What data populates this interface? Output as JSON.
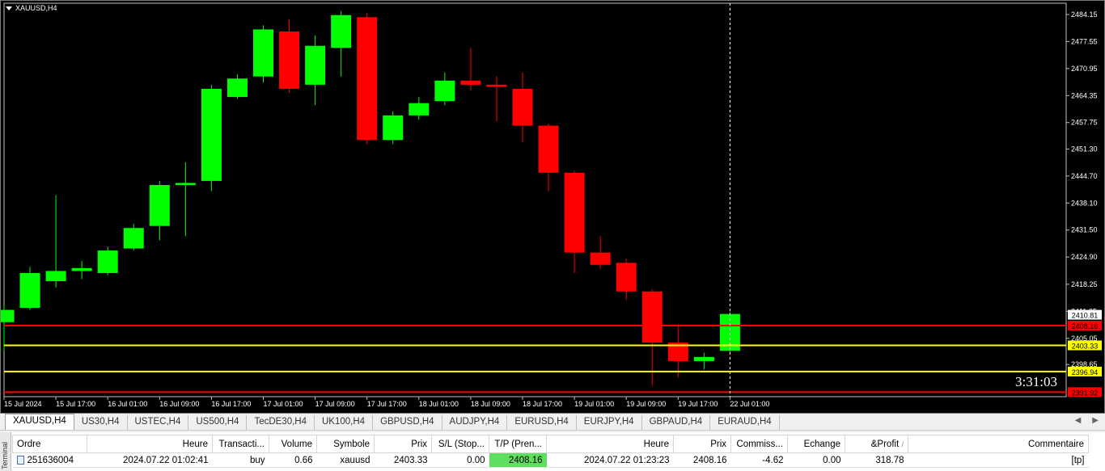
{
  "chart_title": "XAUUSD,H4",
  "countdown": "3:31:03",
  "colors": {
    "background": "#000000",
    "bull": "#00ff00",
    "bear": "#ff0000",
    "axis_text": "#ffffff",
    "yellow_line": "#ffff00",
    "red_line": "#ff0000",
    "tp_highlight": "#5ee05e"
  },
  "chart_data": {
    "type": "candlestick",
    "title": "XAUUSD,H4",
    "ylim": [
      2390.8,
      2486.9
    ],
    "y_ticks": [
      2484.15,
      2477.55,
      2470.95,
      2464.35,
      2457.75,
      2451.3,
      2444.7,
      2438.1,
      2431.5,
      2424.9,
      2418.25,
      2411.65,
      2405.05,
      2398.65
    ],
    "x_labels": [
      "15 Jul 2024",
      "15 Jul 17:00",
      "16 Jul 01:00",
      "16 Jul 09:00",
      "16 Jul 17:00",
      "17 Jul 01:00",
      "17 Jul 09:00",
      "17 Jul 17:00",
      "18 Jul 01:00",
      "18 Jul 09:00",
      "18 Jul 17:00",
      "19 Jul 01:00",
      "19 Jul 09:00",
      "19 Jul 17:00",
      "22 Jul 01:00"
    ],
    "candles": [
      {
        "o": 2409.0,
        "h": 2413.0,
        "l": 2402.0,
        "c": 2412.0
      },
      {
        "o": 2412.5,
        "h": 2422.5,
        "l": 2412.0,
        "c": 2421.0
      },
      {
        "o": 2419.0,
        "h": 2440.0,
        "l": 2417.5,
        "c": 2421.5
      },
      {
        "o": 2421.5,
        "h": 2424.0,
        "l": 2419.5,
        "c": 2422.2
      },
      {
        "o": 2421.0,
        "h": 2427.5,
        "l": 2420.5,
        "c": 2426.5
      },
      {
        "o": 2427.0,
        "h": 2433.0,
        "l": 2426.5,
        "c": 2432.0
      },
      {
        "o": 2432.5,
        "h": 2443.5,
        "l": 2429.0,
        "c": 2442.5
      },
      {
        "o": 2442.5,
        "h": 2448.0,
        "l": 2430.0,
        "c": 2443.0
      },
      {
        "o": 2443.5,
        "h": 2467.0,
        "l": 2441.0,
        "c": 2466.0
      },
      {
        "o": 2464.0,
        "h": 2469.5,
        "l": 2463.5,
        "c": 2468.5
      },
      {
        "o": 2469.0,
        "h": 2481.5,
        "l": 2467.5,
        "c": 2480.5
      },
      {
        "o": 2480.0,
        "h": 2483.0,
        "l": 2465.0,
        "c": 2466.0
      },
      {
        "o": 2467.0,
        "h": 2479.0,
        "l": 2462.0,
        "c": 2476.5
      },
      {
        "o": 2476.0,
        "h": 2485.0,
        "l": 2469.0,
        "c": 2484.0
      },
      {
        "o": 2483.5,
        "h": 2484.5,
        "l": 2452.5,
        "c": 2453.5
      },
      {
        "o": 2453.5,
        "h": 2460.5,
        "l": 2452.5,
        "c": 2459.5
      },
      {
        "o": 2459.5,
        "h": 2464.0,
        "l": 2458.5,
        "c": 2462.5
      },
      {
        "o": 2463.0,
        "h": 2470.0,
        "l": 2462.0,
        "c": 2468.0
      },
      {
        "o": 2468.0,
        "h": 2476.0,
        "l": 2465.5,
        "c": 2467.0
      },
      {
        "o": 2467.0,
        "h": 2469.0,
        "l": 2458.0,
        "c": 2466.5
      },
      {
        "o": 2466.0,
        "h": 2470.0,
        "l": 2453.0,
        "c": 2457.0
      },
      {
        "o": 2457.0,
        "h": 2457.5,
        "l": 2441.0,
        "c": 2445.5
      },
      {
        "o": 2445.5,
        "h": 2446.0,
        "l": 2421.0,
        "c": 2426.0
      },
      {
        "o": 2426.0,
        "h": 2430.0,
        "l": 2422.0,
        "c": 2423.0
      },
      {
        "o": 2423.5,
        "h": 2424.5,
        "l": 2414.5,
        "c": 2416.5
      },
      {
        "o": 2416.5,
        "h": 2417.0,
        "l": 2393.5,
        "c": 2404.0
      },
      {
        "o": 2404.0,
        "h": 2408.5,
        "l": 2395.5,
        "c": 2399.5
      },
      {
        "o": 2399.5,
        "h": 2401.5,
        "l": 2397.5,
        "c": 2400.5
      },
      {
        "o": 2402.0,
        "h": 2411.5,
        "l": 2401.5,
        "c": 2411.0
      }
    ],
    "lines": [
      {
        "price": 2408.16,
        "color": "#ff0000",
        "label": "2408.16"
      },
      {
        "price": 2403.33,
        "color": "#ffff00",
        "label": "2403.33"
      },
      {
        "price": 2396.94,
        "color": "#ffff00",
        "label": "2396.94"
      },
      {
        "price": 2391.92,
        "color": "#ff0000",
        "label": "2391.92"
      }
    ],
    "current_price": {
      "price": 2410.81,
      "label": "2410.81"
    },
    "grid": false
  },
  "tabs": [
    "XAUUSD,H4",
    "US30,H4",
    "USTEC,H4",
    "US500,H4",
    "TecDE30,H4",
    "UK100,H4",
    "GBPUSD,H4",
    "AUDJPY,H4",
    "EURUSD,H4",
    "EURJPY,H4",
    "GBPAUD,H4",
    "EURAUD,H4"
  ],
  "terminal": {
    "side_label": "Terminal",
    "columns": [
      "Ordre",
      "Heure",
      "Transacti...",
      "Volume",
      "Symbole",
      "Prix",
      "S/L (Stop...",
      "T/P (Pren...",
      "Heure",
      "Prix",
      "Commiss...",
      "Echange",
      "&Profit",
      "Commentaire"
    ],
    "sort_mark": "/",
    "row": {
      "ordre": "251636004",
      "heure": "2024.07.22 01:02:41",
      "transaction": "buy",
      "volume": "0.66",
      "symbole": "xauusd",
      "prix": "2403.33",
      "sl": "0.00",
      "tp": "2408.16",
      "heure2": "2024.07.22 01:23:23",
      "prix2": "2408.16",
      "commission": "-4.62",
      "echange": "0.00",
      "profit": "318.78",
      "commentaire": "[tp]"
    }
  }
}
